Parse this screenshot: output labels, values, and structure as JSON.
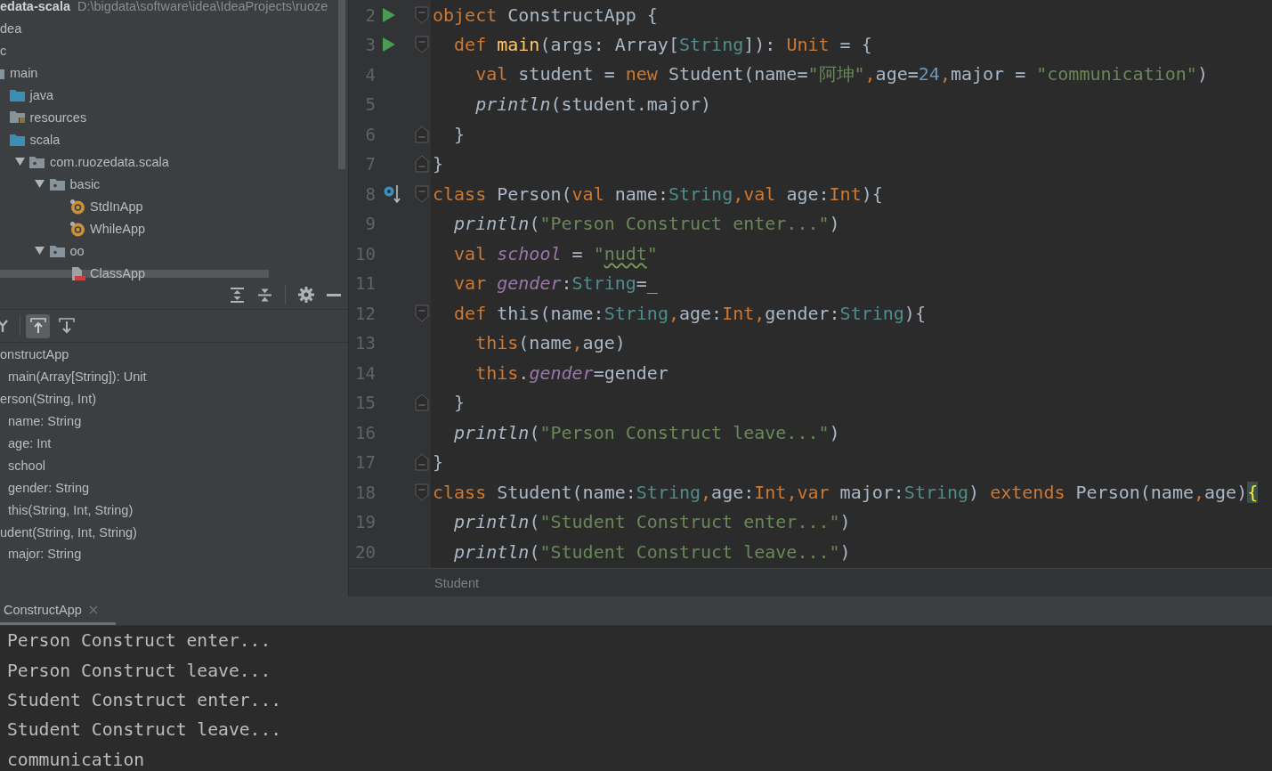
{
  "project_tree": {
    "items": [
      {
        "name": "edata-scala",
        "path": "D:\\bigdata\\software\\idea\\IdeaProjects\\ruoze",
        "children": [
          {
            "name": "dea"
          },
          {
            "name": "c",
            "children": [
              {
                "name": "main",
                "kind": "folder",
                "children": [
                  {
                    "name": "java",
                    "kind": "source-folder"
                  },
                  {
                    "name": "resources",
                    "kind": "resources-folder"
                  },
                  {
                    "name": "scala",
                    "kind": "source-folder",
                    "children": [
                      {
                        "name": "com.ruozedata.scala",
                        "kind": "package",
                        "expanded": true,
                        "children": [
                          {
                            "name": "basic",
                            "kind": "package",
                            "expanded": true,
                            "children": [
                              {
                                "name": "StdInApp",
                                "kind": "object"
                              },
                              {
                                "name": "WhileApp",
                                "kind": "object"
                              }
                            ]
                          },
                          {
                            "name": "oo",
                            "kind": "package",
                            "expanded": true,
                            "children": [
                              {
                                "name": "ClassApp",
                                "kind": "scala-file"
                              }
                            ]
                          }
                        ]
                      }
                    ]
                  }
                ]
              }
            ]
          }
        ]
      }
    ]
  },
  "structure_panel": {
    "toolbar_buttons": [
      {
        "kind": "fork",
        "selected": false
      },
      {
        "kind": "up",
        "selected": true
      },
      {
        "kind": "down",
        "selected": false
      }
    ],
    "items": [
      {
        "name": "onstructApp",
        "children": [
          {
            "name": "main(Array[String]): Unit"
          }
        ]
      },
      {
        "name": "erson(String, Int)",
        "children": [
          {
            "name": "name: String"
          },
          {
            "name": "age: Int"
          },
          {
            "name": "school"
          },
          {
            "name": "gender: String"
          },
          {
            "name": "this(String, Int, String)"
          }
        ]
      },
      {
        "name": "udent(String, Int, String)",
        "children": [
          {
            "name": "major: String"
          }
        ]
      }
    ]
  },
  "editor": {
    "lines": [
      {
        "number": "2",
        "runnable": true,
        "fold_start": true,
        "tokens": [
          {
            "kind": "kw",
            "text": "object "
          },
          {
            "kind": "plain",
            "text": "ConstructApp {"
          }
        ]
      },
      {
        "number": "3",
        "runnable": true,
        "fold_start": true,
        "tokens": [
          {
            "kind": "kw",
            "text": "  def "
          },
          {
            "kind": "fn",
            "text": "main"
          },
          {
            "kind": "plain",
            "text": "(args: Array["
          },
          {
            "kind": "type",
            "text": "String"
          },
          {
            "kind": "plain",
            "text": "]): "
          },
          {
            "kind": "kw",
            "text": "Unit"
          },
          {
            "kind": "plain",
            "text": " = {"
          }
        ]
      },
      {
        "number": "4",
        "tokens": [
          {
            "kind": "kw",
            "text": "    val "
          },
          {
            "kind": "plain",
            "text": "student = "
          },
          {
            "kind": "kw",
            "text": "new "
          },
          {
            "kind": "plain",
            "text": "Student(name="
          },
          {
            "kind": "str",
            "text": "\"阿坤\""
          },
          {
            "kind": "kw",
            "text": ","
          },
          {
            "kind": "plain",
            "text": "age="
          },
          {
            "kind": "num",
            "text": "24"
          },
          {
            "kind": "kw",
            "text": ","
          },
          {
            "kind": "plain",
            "text": "major = "
          },
          {
            "kind": "str",
            "text": "\"communication\""
          },
          {
            "kind": "plain",
            "text": ")"
          }
        ]
      },
      {
        "number": "5",
        "tokens": [
          {
            "kind": "call",
            "text": "    println"
          },
          {
            "kind": "plain",
            "text": "(student.major)"
          }
        ]
      },
      {
        "number": "6",
        "fold_end": true,
        "tokens": [
          {
            "kind": "plain",
            "text": "  }"
          }
        ]
      },
      {
        "number": "7",
        "fold_end": true,
        "tokens": [
          {
            "kind": "plain",
            "text": "}"
          }
        ]
      },
      {
        "number": "8",
        "overrides": true,
        "fold_start": true,
        "tokens": [
          {
            "kind": "kw",
            "text": "class "
          },
          {
            "kind": "plain",
            "text": "Person("
          },
          {
            "kind": "kw",
            "text": "val "
          },
          {
            "kind": "plain",
            "text": "name:"
          },
          {
            "kind": "type",
            "text": "String"
          },
          {
            "kind": "kw",
            "text": ",val "
          },
          {
            "kind": "plain",
            "text": "age:"
          },
          {
            "kind": "kw",
            "text": "Int"
          },
          {
            "kind": "plain",
            "text": "){"
          }
        ]
      },
      {
        "number": "9",
        "tokens": [
          {
            "kind": "call",
            "text": "  println"
          },
          {
            "kind": "plain",
            "text": "("
          },
          {
            "kind": "str",
            "text": "\"Person Construct enter...\""
          },
          {
            "kind": "plain",
            "text": ")"
          }
        ]
      },
      {
        "number": "10",
        "tokens": [
          {
            "kind": "kw",
            "text": "  val "
          },
          {
            "kind": "field",
            "text": "school"
          },
          {
            "kind": "plain",
            "text": " = "
          },
          {
            "kind": "str",
            "text": "\""
          },
          {
            "kind": "typo",
            "text": "nudt"
          },
          {
            "kind": "str",
            "text": "\""
          }
        ]
      },
      {
        "number": "11",
        "tokens": [
          {
            "kind": "kw",
            "text": "  var "
          },
          {
            "kind": "field",
            "text": "gender"
          },
          {
            "kind": "plain",
            "text": ":"
          },
          {
            "kind": "type",
            "text": "String"
          },
          {
            "kind": "plain",
            "text": "=_"
          }
        ]
      },
      {
        "number": "12",
        "fold_start": true,
        "tokens": [
          {
            "kind": "kw",
            "text": "  def "
          },
          {
            "kind": "plain",
            "text": "this(name:"
          },
          {
            "kind": "type",
            "text": "String"
          },
          {
            "kind": "kw",
            "text": ","
          },
          {
            "kind": "plain",
            "text": "age:"
          },
          {
            "kind": "kw",
            "text": "Int"
          },
          {
            "kind": "kw",
            "text": ","
          },
          {
            "kind": "plain",
            "text": "gender:"
          },
          {
            "kind": "type",
            "text": "String"
          },
          {
            "kind": "plain",
            "text": "){"
          }
        ]
      },
      {
        "number": "13",
        "tokens": [
          {
            "kind": "kw",
            "text": "    this"
          },
          {
            "kind": "plain",
            "text": "(name"
          },
          {
            "kind": "kw",
            "text": ","
          },
          {
            "kind": "plain",
            "text": "age)"
          }
        ]
      },
      {
        "number": "14",
        "tokens": [
          {
            "kind": "kw",
            "text": "    this"
          },
          {
            "kind": "plain",
            "text": "."
          },
          {
            "kind": "field",
            "text": "gender"
          },
          {
            "kind": "plain",
            "text": "=gender"
          }
        ]
      },
      {
        "number": "15",
        "fold_end": true,
        "tokens": [
          {
            "kind": "plain",
            "text": "  }"
          }
        ]
      },
      {
        "number": "16",
        "tokens": [
          {
            "kind": "call",
            "text": "  println"
          },
          {
            "kind": "plain",
            "text": "("
          },
          {
            "kind": "str",
            "text": "\"Person Construct leave...\""
          },
          {
            "kind": "plain",
            "text": ")"
          }
        ]
      },
      {
        "number": "17",
        "fold_end": true,
        "tokens": [
          {
            "kind": "plain",
            "text": "}"
          }
        ]
      },
      {
        "number": "18",
        "fold_start": true,
        "tokens": [
          {
            "kind": "kw",
            "text": "class "
          },
          {
            "kind": "plain",
            "text": "Student(name:"
          },
          {
            "kind": "type",
            "text": "String"
          },
          {
            "kind": "kw",
            "text": ","
          },
          {
            "kind": "plain",
            "text": "age:"
          },
          {
            "kind": "kw",
            "text": "Int"
          },
          {
            "kind": "kw",
            "text": ","
          },
          {
            "kind": "kw",
            "text": "var "
          },
          {
            "kind": "plain",
            "text": "major:"
          },
          {
            "kind": "type",
            "text": "String"
          },
          {
            "kind": "plain",
            "text": ") "
          },
          {
            "kind": "kw",
            "text": "extends "
          },
          {
            "kind": "plain",
            "text": "Person(name"
          },
          {
            "kind": "kw",
            "text": ","
          },
          {
            "kind": "plain",
            "text": "age)"
          },
          {
            "kind": "brace",
            "text": "{"
          }
        ]
      },
      {
        "number": "19",
        "tokens": [
          {
            "kind": "call",
            "text": "  println"
          },
          {
            "kind": "plain",
            "text": "("
          },
          {
            "kind": "str",
            "text": "\"Student Construct enter...\""
          },
          {
            "kind": "plain",
            "text": ")"
          }
        ]
      },
      {
        "number": "20",
        "tokens": [
          {
            "kind": "call",
            "text": "  println"
          },
          {
            "kind": "plain",
            "text": "("
          },
          {
            "kind": "str",
            "text": "\"Student Construct leave...\""
          },
          {
            "kind": "plain",
            "text": ")"
          }
        ]
      }
    ],
    "breadcrumb": "Student"
  },
  "run_panel": {
    "tabs": [
      {
        "label": "ConstructApp",
        "selected": true
      }
    ],
    "output": [
      "Person Construct enter...",
      "Person Construct leave...",
      "Student Construct enter...",
      "Student Construct leave...",
      "communication"
    ]
  }
}
